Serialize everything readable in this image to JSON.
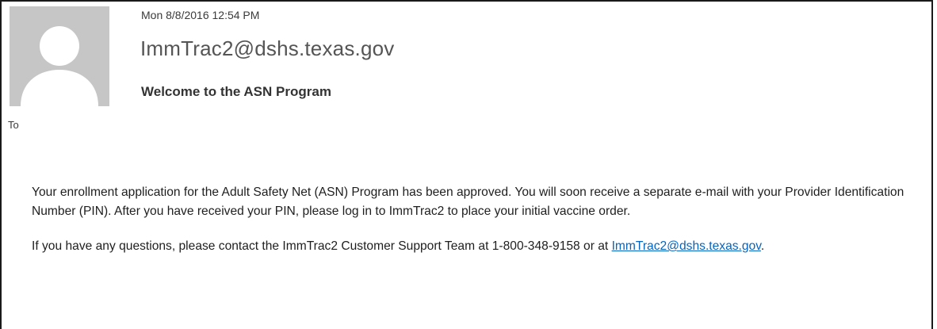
{
  "message": {
    "date": "Mon 8/8/2016 12:54 PM",
    "sender": "ImmTrac2@dshs.texas.gov",
    "subject": "Welcome to the ASN Program",
    "to_label": "To"
  },
  "avatar": {
    "icon": "person-silhouette-icon",
    "background_color": "#c6c6c6",
    "figure_color": "#ffffff"
  },
  "body": {
    "paragraph1": "Your enrollment application for the Adult Safety Net (ASN) Program has been approved. You will soon receive a separate e-mail with your Provider Identification Number (PIN). After you have received your PIN, please log in to ImmTrac2 to place your initial vaccine order.",
    "paragraph2_prefix": "If you have any questions, please contact the ImmTrac2 Customer Support Team at 1-800-348-9158 or at ",
    "paragraph2_link": "ImmTrac2@dshs.texas.gov",
    "paragraph2_suffix": ".",
    "link_color": "#0563c1"
  }
}
